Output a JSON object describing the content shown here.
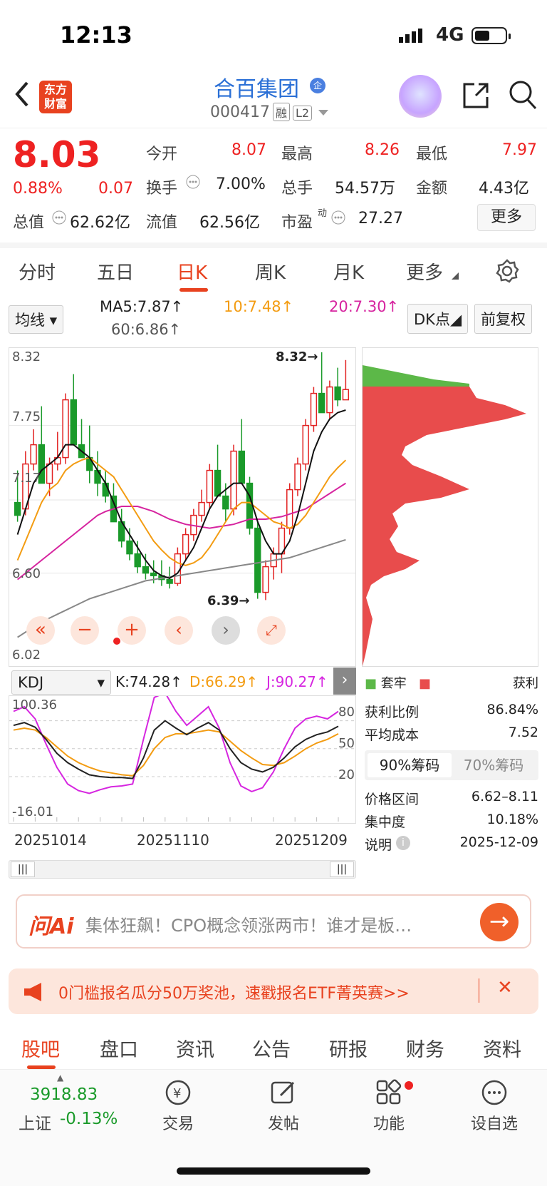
{
  "status": {
    "time": "12:13",
    "network": "4G"
  },
  "header": {
    "logo": "东方财富",
    "stock_name": "合百集团",
    "stock_code": "000417",
    "tag1": "融",
    "tag2": "L2"
  },
  "quote": {
    "price": "8.03",
    "change_pct": "0.88%",
    "change": "0.07",
    "open_label": "今开",
    "open": "8.07",
    "high_label": "最高",
    "high": "8.26",
    "low_label": "最低",
    "low": "7.97",
    "turnover_label": "换手",
    "turnover": "7.00%",
    "volume_label": "总手",
    "volume": "54.57万",
    "amount_label": "金额",
    "amount": "4.43亿",
    "mktcap_label": "总值",
    "mktcap": "62.62亿",
    "float_label": "流值",
    "float": "62.56亿",
    "pe_label": "市盈",
    "pe_sup": "动",
    "pe": "27.27",
    "more": "更多"
  },
  "tabs": [
    "分时",
    "五日",
    "日K",
    "周K",
    "月K",
    "更多"
  ],
  "ma": {
    "selector": "均线",
    "ma5": "MA5:7.87↑",
    "ma10": "10:7.48↑",
    "ma20": "20:7.30↑",
    "ma60": "60:6.86↑",
    "dk": "DK点",
    "fq": "前复权"
  },
  "chart_labels": {
    "y_top": "8.32",
    "y1": "7.75",
    "y2": "7.17",
    "y3": "6.60",
    "y_bot": "6.02",
    "max_mark": "8.32→",
    "min_mark": "6.39→"
  },
  "kdj": {
    "selector": "KDJ",
    "k": "K:74.28↑",
    "d": "D:66.29↑",
    "j": "J:90.27↑",
    "top": "100.36",
    "bot": "-16.01",
    "l80": "80",
    "l50": "50",
    "l20": "20"
  },
  "dates": [
    "20251014",
    "20251110",
    "20251209"
  ],
  "chips": {
    "legend_loss": "套牢",
    "legend_gain": "获利",
    "profit_label": "获利比例",
    "profit": "86.84%",
    "avg_label": "平均成本",
    "avg": "7.52",
    "seg90": "90%筹码",
    "seg70": "70%筹码",
    "range_label": "价格区间",
    "range": "6.62–8.11",
    "conc_label": "集中度",
    "conc": "10.18%",
    "note_label": "说明",
    "note": "2025-12-09"
  },
  "ai": {
    "logo": "问Ai",
    "text": "集体狂飙！CPO概念领涨两市！谁才是板…"
  },
  "ad": {
    "text": "0门槛报名瓜分50万奖池，速戳报名ETF菁英赛>>"
  },
  "subtabs": [
    "股吧",
    "盘口",
    "资讯",
    "公告",
    "研报",
    "财务",
    "资料"
  ],
  "bottom": {
    "index_value": "3918.83",
    "index_name": "上证",
    "index_change": "-0.13%",
    "trade": "交易",
    "post": "发帖",
    "func": "功能",
    "watch": "设自选"
  },
  "colors": {
    "up": "#e22222",
    "down": "#1a9a2a",
    "accent": "#e8421f"
  },
  "chart_data": {
    "type": "candlestick",
    "ylim": [
      6.02,
      8.32
    ],
    "x_dates": [
      "20251014",
      "20251110",
      "20251209"
    ],
    "ohlc": [
      [
        7.15,
        7.4,
        7.0,
        7.05
      ],
      [
        7.1,
        7.55,
        7.05,
        7.45
      ],
      [
        7.45,
        7.72,
        7.4,
        7.6
      ],
      [
        7.6,
        7.9,
        7.5,
        7.3
      ],
      [
        7.3,
        7.5,
        7.2,
        7.45
      ],
      [
        7.45,
        7.7,
        7.4,
        7.5
      ],
      [
        7.5,
        8.0,
        7.45,
        7.95
      ],
      [
        7.95,
        8.15,
        7.7,
        7.6
      ],
      [
        7.6,
        7.8,
        7.5,
        7.5
      ],
      [
        7.5,
        7.75,
        7.3,
        7.4
      ],
      [
        7.4,
        7.55,
        7.2,
        7.3
      ],
      [
        7.3,
        7.4,
        7.15,
        7.2
      ],
      [
        7.2,
        7.3,
        7.05,
        7.0
      ],
      [
        7.0,
        7.1,
        6.8,
        6.85
      ],
      [
        6.85,
        6.95,
        6.7,
        6.75
      ],
      [
        6.75,
        6.85,
        6.6,
        6.65
      ],
      [
        6.65,
        6.75,
        6.55,
        6.6
      ],
      [
        6.6,
        6.7,
        6.52,
        6.58
      ],
      [
        6.58,
        6.7,
        6.5,
        6.55
      ],
      [
        6.55,
        6.65,
        6.48,
        6.52
      ],
      [
        6.52,
        6.8,
        6.5,
        6.75
      ],
      [
        6.75,
        6.95,
        6.7,
        6.9
      ],
      [
        6.9,
        7.1,
        6.85,
        7.05
      ],
      [
        7.05,
        7.25,
        7.0,
        7.15
      ],
      [
        7.15,
        7.45,
        7.1,
        7.4
      ],
      [
        7.4,
        7.6,
        7.3,
        7.2
      ],
      [
        7.2,
        7.3,
        7.0,
        7.1
      ],
      [
        7.1,
        7.6,
        7.05,
        7.55
      ],
      [
        7.55,
        7.8,
        7.4,
        7.3
      ],
      [
        7.3,
        7.35,
        6.9,
        6.95
      ],
      [
        6.95,
        7.0,
        6.4,
        6.45
      ],
      [
        6.45,
        6.7,
        6.39,
        6.65
      ],
      [
        6.65,
        6.8,
        6.55,
        6.75
      ],
      [
        6.75,
        7.0,
        6.6,
        6.95
      ],
      [
        6.95,
        7.3,
        6.9,
        7.25
      ],
      [
        7.25,
        7.5,
        7.2,
        7.45
      ],
      [
        7.45,
        7.8,
        7.4,
        7.75
      ],
      [
        7.75,
        8.05,
        7.7,
        8.0
      ],
      [
        8.0,
        8.32,
        7.95,
        7.85
      ],
      [
        7.85,
        8.1,
        7.8,
        8.05
      ],
      [
        8.05,
        8.2,
        7.9,
        7.95
      ],
      [
        7.95,
        8.26,
        7.97,
        8.03
      ]
    ],
    "ma5": [
      6.9,
      7.1,
      7.3,
      7.4,
      7.45,
      7.5,
      7.6,
      7.6,
      7.55,
      7.5,
      7.4,
      7.3,
      7.15,
      7.0,
      6.9,
      6.8,
      6.7,
      6.62,
      6.58,
      6.56,
      6.6,
      6.7,
      6.8,
      6.95,
      7.1,
      7.2,
      7.25,
      7.3,
      7.3,
      7.2,
      7.0,
      6.85,
      6.75,
      6.75,
      6.85,
      7.05,
      7.3,
      7.55,
      7.7,
      7.8,
      7.85,
      7.87
    ],
    "ma10": [
      6.7,
      6.85,
      7.0,
      7.15,
      7.25,
      7.3,
      7.4,
      7.45,
      7.48,
      7.5,
      7.45,
      7.4,
      7.35,
      7.25,
      7.15,
      7.05,
      6.95,
      6.85,
      6.78,
      6.72,
      6.68,
      6.66,
      6.68,
      6.72,
      6.8,
      6.9,
      7.0,
      7.1,
      7.15,
      7.15,
      7.1,
      7.05,
      7.0,
      6.98,
      6.95,
      6.98,
      7.05,
      7.15,
      7.25,
      7.35,
      7.42,
      7.48
    ],
    "ma20": [
      6.55,
      6.6,
      6.65,
      6.7,
      6.75,
      6.8,
      6.85,
      6.9,
      6.95,
      7.0,
      7.05,
      7.08,
      7.1,
      7.12,
      7.12,
      7.12,
      7.1,
      7.08,
      7.05,
      7.02,
      7.0,
      6.98,
      6.97,
      6.96,
      6.95,
      6.96,
      6.97,
      6.98,
      7.0,
      7.02,
      7.02,
      7.02,
      7.03,
      7.04,
      7.06,
      7.08,
      7.1,
      7.14,
      7.18,
      7.22,
      7.26,
      7.3
    ],
    "ma60": [
      6.1,
      6.14,
      6.18,
      6.22,
      6.25,
      6.28,
      6.31,
      6.34,
      6.37,
      6.4,
      6.42,
      6.44,
      6.46,
      6.48,
      6.5,
      6.52,
      6.54,
      6.55,
      6.56,
      6.57,
      6.58,
      6.59,
      6.6,
      6.61,
      6.62,
      6.63,
      6.64,
      6.65,
      6.66,
      6.67,
      6.68,
      6.69,
      6.7,
      6.71,
      6.72,
      6.74,
      6.76,
      6.78,
      6.8,
      6.82,
      6.84,
      6.86
    ],
    "kdj_k": [
      75,
      78,
      73,
      60,
      45,
      35,
      28,
      22,
      20,
      19,
      19,
      18,
      40,
      70,
      80,
      72,
      65,
      72,
      78,
      70,
      50,
      35,
      28,
      25,
      30,
      40,
      52,
      60,
      65,
      68,
      74
    ],
    "kdj_d": [
      70,
      72,
      70,
      62,
      52,
      42,
      35,
      30,
      26,
      24,
      22,
      21,
      32,
      50,
      62,
      66,
      66,
      68,
      70,
      68,
      58,
      48,
      40,
      33,
      32,
      35,
      42,
      50,
      56,
      60,
      66
    ],
    "kdj_j": [
      90,
      95,
      82,
      55,
      30,
      12,
      5,
      2,
      6,
      9,
      10,
      12,
      60,
      105,
      110,
      90,
      75,
      85,
      95,
      72,
      35,
      10,
      4,
      8,
      25,
      50,
      72,
      82,
      85,
      82,
      90
    ]
  }
}
